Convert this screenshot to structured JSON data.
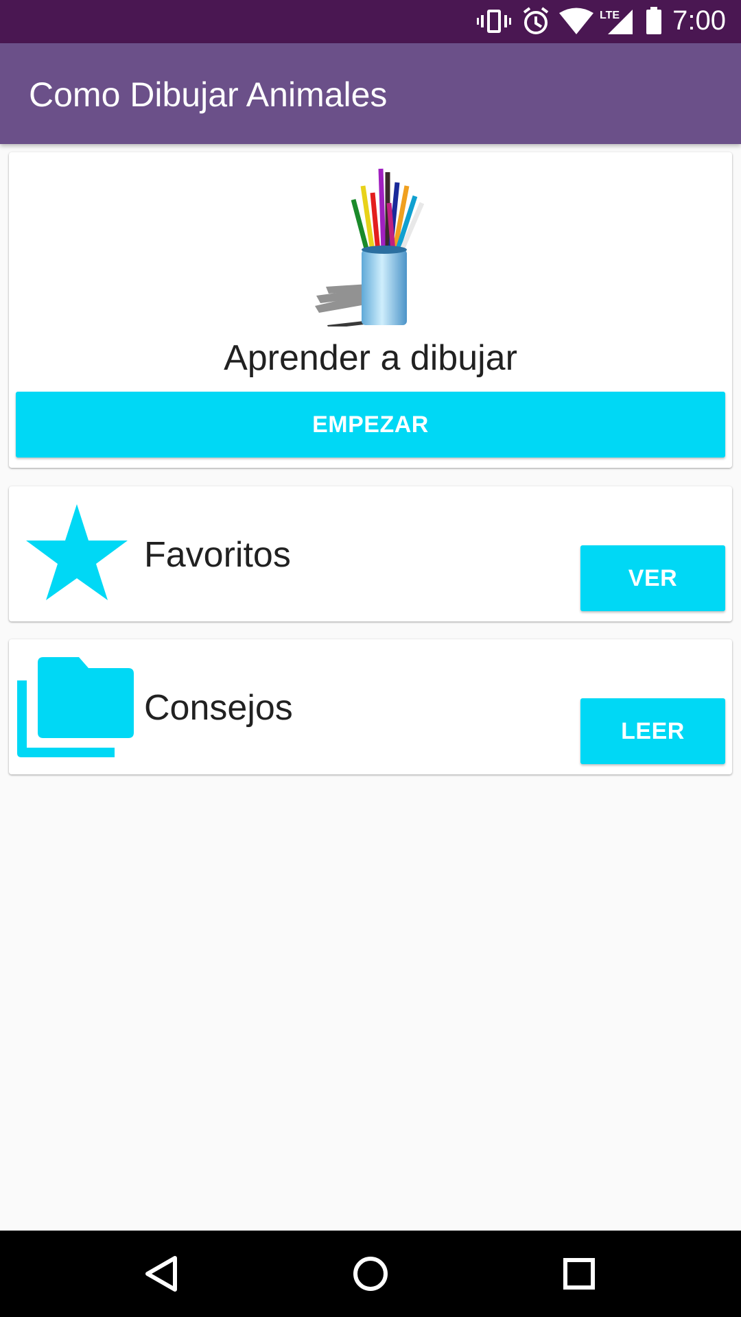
{
  "status_bar": {
    "time": "7:00",
    "network_label": "LTE",
    "icons": [
      "vibrate-icon",
      "alarm-icon",
      "wifi-icon",
      "cell-signal-icon",
      "battery-icon"
    ]
  },
  "app_bar": {
    "title": "Como Dibujar Animales"
  },
  "cards": {
    "learn": {
      "image": "pencil-cup-illustration",
      "title": "Aprender a dibujar",
      "button_label": "EMPEZAR"
    },
    "favorites": {
      "icon": "star-icon",
      "label": "Favoritos",
      "button_label": "VER"
    },
    "tips": {
      "icon": "folder-icon",
      "label": "Consejos",
      "button_label": "LEER"
    }
  },
  "nav_bar": {
    "buttons": [
      "back-icon",
      "home-icon",
      "recents-icon"
    ]
  },
  "colors": {
    "status_bar": "#4a1752",
    "app_bar": "#6b5089",
    "accent": "#00d8f5",
    "background": "#fafafa",
    "text": "#212121"
  }
}
